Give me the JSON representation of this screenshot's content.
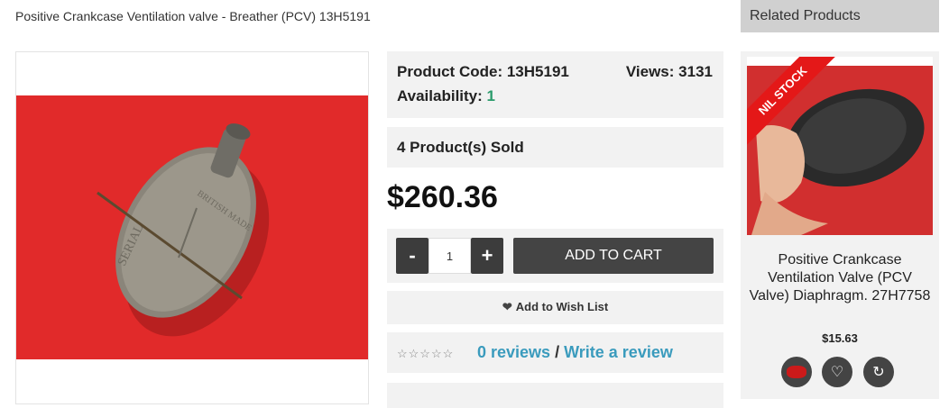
{
  "page": {
    "title": "Positive Crankcase Ventilation valve - Breather (PCV) 13H5191"
  },
  "product": {
    "code_label": "Product Code:",
    "code_value": "13H5191",
    "views_label": "Views:",
    "views_value": "3131",
    "availability_label": "Availability:",
    "availability_value": "1",
    "sold_text": "4 Product(s) Sold",
    "price": "$260.36",
    "qty_minus": "-",
    "qty_plus": "+",
    "qty_value": "1",
    "add_to_cart": "ADD TO CART",
    "wish_list": "Add to Wish List",
    "stars": "☆☆☆☆☆",
    "reviews_link": "0 reviews",
    "review_sep": "/",
    "write_review": "Write a review"
  },
  "related": {
    "heading": "Related Products",
    "badge": "NIL STOCK",
    "name": "Positive Crankcase Ventilation Valve (PCV Valve) Diaphragm. 27H7758",
    "price": "$15.63",
    "wish_icon": "heart-icon",
    "compare_icon": "refresh-icon",
    "cart_icon": "cart-icon"
  },
  "colors": {
    "accent_link": "#3a9bbd",
    "availability": "#2a9b6b",
    "button_dark": "#444444",
    "photo_red": "#e12a2a",
    "ribbon_red": "#e41818"
  }
}
